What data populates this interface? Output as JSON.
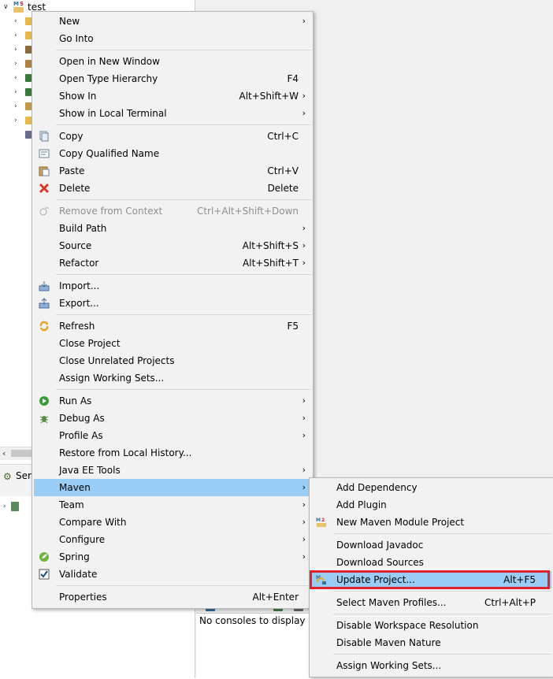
{
  "explorer": {
    "project_name": "test",
    "children_colors": [
      "#e8b84a",
      "#e8b84a",
      "#8a6a3a",
      "#b08040",
      "#3a7a3a",
      "#3a7a3a",
      "#c09a4a",
      "#e8b84a",
      "#6a6a8a"
    ]
  },
  "servers": {
    "tab_label": "Ser"
  },
  "console": {
    "message": "No consoles to display at"
  },
  "context_menu": {
    "items": [
      {
        "label": "New",
        "submenu": true
      },
      {
        "label": "Go Into"
      },
      {
        "label": "Open in New Window"
      },
      {
        "label": "Open Type Hierarchy",
        "shortcut": "F4"
      },
      {
        "label": "Show In",
        "shortcut": "Alt+Shift+W",
        "submenu": true
      },
      {
        "label": "Show in Local Terminal",
        "submenu": true
      },
      {
        "label": "Copy",
        "shortcut": "Ctrl+C",
        "icon": "copy-icon"
      },
      {
        "label": "Copy Qualified Name",
        "icon": "copy-qualified-name-icon"
      },
      {
        "label": "Paste",
        "shortcut": "Ctrl+V",
        "icon": "paste-icon"
      },
      {
        "label": "Delete",
        "shortcut": "Delete",
        "icon": "delete-icon"
      },
      {
        "label": "Remove from Context",
        "shortcut": "Ctrl+Alt+Shift+Down",
        "disabled": true,
        "icon": "remove-from-context-icon"
      },
      {
        "label": "Build Path",
        "submenu": true
      },
      {
        "label": "Source",
        "shortcut": "Alt+Shift+S",
        "submenu": true
      },
      {
        "label": "Refactor",
        "shortcut": "Alt+Shift+T",
        "submenu": true
      },
      {
        "label": "Import...",
        "icon": "import-icon"
      },
      {
        "label": "Export...",
        "icon": "export-icon"
      },
      {
        "label": "Refresh",
        "shortcut": "F5",
        "icon": "refresh-icon"
      },
      {
        "label": "Close Project"
      },
      {
        "label": "Close Unrelated Projects"
      },
      {
        "label": "Assign Working Sets..."
      },
      {
        "label": "Run As",
        "submenu": true,
        "icon": "run-icon"
      },
      {
        "label": "Debug As",
        "submenu": true,
        "icon": "debug-icon"
      },
      {
        "label": "Profile As",
        "submenu": true
      },
      {
        "label": "Restore from Local History..."
      },
      {
        "label": "Java EE Tools",
        "submenu": true
      },
      {
        "label": "Maven",
        "submenu": true,
        "highlighted": true
      },
      {
        "label": "Team",
        "submenu": true
      },
      {
        "label": "Compare With",
        "submenu": true
      },
      {
        "label": "Configure",
        "submenu": true
      },
      {
        "label": "Spring",
        "submenu": true,
        "icon": "spring-icon"
      },
      {
        "label": "Validate",
        "icon": "validate-checkbox-icon"
      },
      {
        "label": "Properties",
        "shortcut": "Alt+Enter"
      }
    ]
  },
  "maven_submenu": {
    "items": [
      {
        "label": "Add Dependency"
      },
      {
        "label": "Add Plugin"
      },
      {
        "label": "New Maven Module Project",
        "icon": "maven-module-icon"
      },
      {
        "label": "Download Javadoc"
      },
      {
        "label": "Download Sources"
      },
      {
        "label": "Update Project...",
        "shortcut": "Alt+F5",
        "highlighted": true,
        "icon": "update-project-icon"
      },
      {
        "label": "Select Maven Profiles...",
        "shortcut": "Ctrl+Alt+P"
      },
      {
        "label": "Disable Workspace Resolution"
      },
      {
        "label": "Disable Maven Nature"
      },
      {
        "label": "Assign Working Sets..."
      }
    ]
  },
  "colors": {
    "menu_background": "#f2f2f2",
    "highlight": "#99cdf6",
    "selection_box": "#e4202e",
    "disabled_text": "#8f8f8f"
  }
}
